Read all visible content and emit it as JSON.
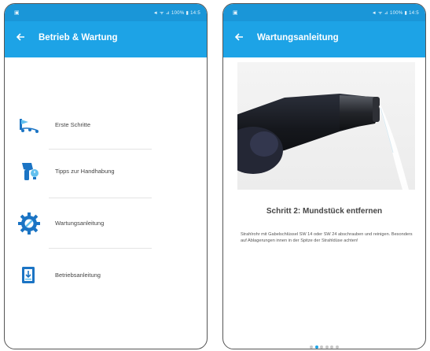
{
  "status_bar": {
    "left_glyph": "▣",
    "right_text": "◄ ᯤ ⊿ 100% ▮ 14:5"
  },
  "screen_left": {
    "title": "Betrieb & Wartung",
    "back_icon": "arrow-left-icon",
    "items": [
      {
        "label": "Erste Schritte",
        "icon": "first-steps-icon"
      },
      {
        "label": "Tipps zur Handhabung",
        "icon": "handling-tips-icon"
      },
      {
        "label": "Wartungsanleitung",
        "icon": "maintenance-gear-icon"
      },
      {
        "label": "Betriebsanleitung",
        "icon": "manual-download-icon"
      }
    ]
  },
  "screen_right": {
    "title": "Wartungsanleitung",
    "back_icon": "arrow-left-icon",
    "step_title": "Schritt 2: Mundstück entfernen",
    "step_text": "Strahlrohr mit Gabelschlüssel SW 14 oder SW 24 abschrauben und reinigen. Besonders auf Ablagerungen innen in der Spitze der Strahldüse achten!",
    "pager": {
      "total": 6,
      "active": 2
    }
  },
  "colors": {
    "status_bar": "#1a96d8",
    "toolbar": "#1da3e6",
    "icon_blue": "#1b74c4",
    "icon_light": "#63c0ee"
  }
}
